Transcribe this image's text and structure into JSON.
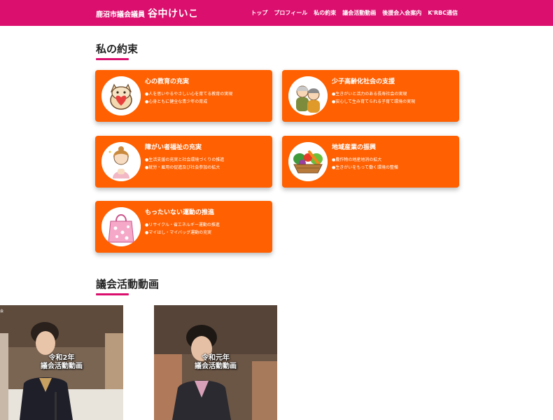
{
  "header": {
    "brand_sub": "鹿沼市議会議員",
    "brand_name": "谷中けいこ",
    "nav": [
      "トップ",
      "プロフィール",
      "私の約束",
      "議会活動動画",
      "後援会入会案内",
      "K'RBC通信"
    ]
  },
  "promises": {
    "title": "私の約束",
    "cards": [
      {
        "icon": "owl-heart-icon",
        "title": "心の教育の充実",
        "items": [
          "●人を思いやるやさしい心を育てる教育の実現",
          "●心身ともに健全な青少年の育成"
        ]
      },
      {
        "icon": "elderly-couple-icon",
        "title": "少子高齢化社会の支援",
        "items": [
          "●生きがいと活力のある長寿社会の実現",
          "●安心して生み育てられる子育て環境の実現"
        ]
      },
      {
        "icon": "caregiver-icon",
        "title": "障がい者福祉の充実",
        "items": [
          "●生活支援の充実と社会環境づくりの推進",
          "●就労・雇用の促進及び社会参加の拡大"
        ]
      },
      {
        "icon": "vegetable-basket-icon",
        "title": "地域産業の振興",
        "items": [
          "●農作物の地産地消の拡大",
          "●生きがいをもって働く環境の整備"
        ]
      },
      {
        "icon": "shopping-bag-icon",
        "title": "もったいない運動の推進",
        "items": [
          "●リサイクル・省エネルギー運動の推進",
          "●マイはし・マイバッグ運動の充実"
        ]
      }
    ]
  },
  "videos": {
    "title": "議会活動動画",
    "items": [
      {
        "caption_line1": "令和2年",
        "caption_line2": "議会活動動画",
        "corner_text": "会"
      },
      {
        "caption_line1": "令和元年",
        "caption_line2": "議会活動動画"
      }
    ]
  },
  "colors": {
    "brand": "#db0f6e",
    "card": "#ff6001"
  }
}
